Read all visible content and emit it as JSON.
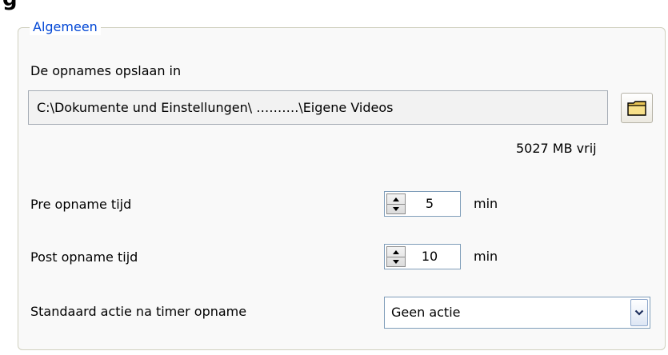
{
  "group": {
    "title": "Algemeen"
  },
  "save": {
    "label": "De opnames opslaan in",
    "path": "C:\\Dokumente und Einstellungen\\ ……….\\Eigene Videos",
    "free_space": "5027 MB vrij",
    "browse_icon": "folder-icon"
  },
  "pre": {
    "label": "Pre opname tijd",
    "value": "5",
    "unit": "min"
  },
  "post": {
    "label": "Post opname tijd",
    "value": "10",
    "unit": "min"
  },
  "action": {
    "label": "Standaard actie na timer opname",
    "selected": "Geen actie"
  },
  "colors": {
    "legend": "#0046d5",
    "border": "#d0d0bf",
    "panel": "#f9f9f9"
  }
}
